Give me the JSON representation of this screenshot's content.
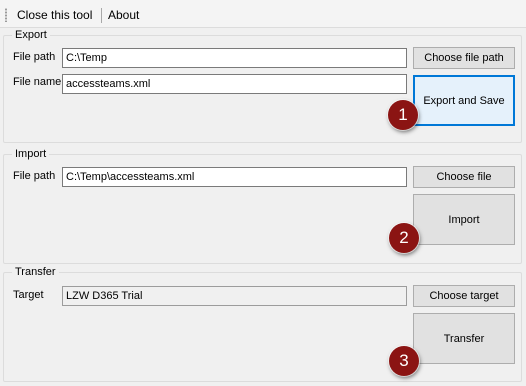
{
  "menu": {
    "close_tool": "Close this tool",
    "about": "About"
  },
  "export": {
    "title": "Export",
    "file_path_label": "File path",
    "file_path_value": "C:\\Temp",
    "choose_path_button": "Choose file path",
    "file_name_label": "File name",
    "file_name_value": "accessteams.xml",
    "action_button": "Export and Save",
    "step": "1"
  },
  "import": {
    "title": "Import",
    "file_path_label": "File path",
    "file_path_value": "C:\\Temp\\accessteams.xml",
    "choose_file_button": "Choose file",
    "action_button": "Import",
    "step": "2"
  },
  "transfer": {
    "title": "Transfer",
    "target_label": "Target",
    "target_value": "LZW D365 Trial",
    "choose_target_button": "Choose target",
    "action_button": "Transfer",
    "step": "3"
  },
  "colors": {
    "badge": "#8b1413",
    "focus_border": "#0078d7",
    "button_face": "#e1e1e1"
  }
}
